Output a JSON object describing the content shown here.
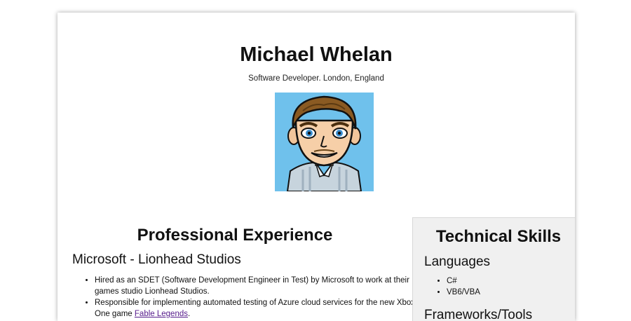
{
  "header": {
    "name": "Michael Whelan",
    "subtitle": "Software Developer. London, England"
  },
  "experience": {
    "title": "Professional Experience",
    "company": "Microsoft - Lionhead Studios",
    "bullets": [
      "Hired as an SDET (Software Development Engineer in Test) by Microsoft to work at their games studio Lionhead Studios.",
      "Responsible for implementing automated testing of Azure cloud services for the new Xbox One game "
    ],
    "link_text": "Fable Legends",
    "link_suffix": "."
  },
  "skills": {
    "title": "Technical Skills",
    "languages_heading": "Languages",
    "languages": [
      "C#",
      "VB6/VBA"
    ],
    "frameworks_heading": "Frameworks/Tools"
  },
  "colors": {
    "avatar_bg": "#6fc1ec",
    "link": "#551a8b",
    "skills_bg": "#f0f0f0"
  },
  "icons": {
    "avatar": "cartoon-avatar-icon"
  }
}
